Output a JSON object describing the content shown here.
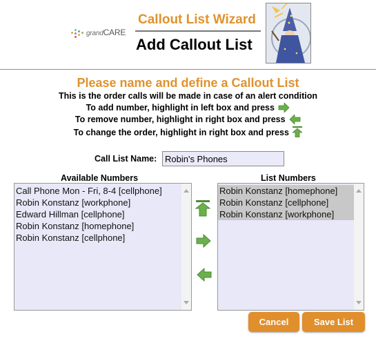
{
  "header": {
    "logo_text_grand": "grand",
    "logo_text_care": "CARE",
    "wizard_title": "Callout List Wizard",
    "page_title": "Add Callout List"
  },
  "instructions": {
    "subtitle": "Please name and define a Callout List",
    "line1": "This is the order calls will be made in case of an alert condition",
    "line2": "To add number, highlight in left box and press",
    "line3": "To remove number, highlight in right box and press",
    "line4": "To change the order, highlight in right box and press"
  },
  "form": {
    "name_label": "Call List Name:",
    "name_value": "Robin's Phones"
  },
  "available": {
    "label": "Available Numbers",
    "items": [
      "Call Phone Mon - Fri, 8-4 [cellphone]",
      "Robin Konstanz [workphone]",
      "Edward Hillman [cellphone]",
      "Robin Konstanz [homephone]",
      "Robin Konstanz [cellphone]"
    ]
  },
  "list": {
    "label": "List Numbers",
    "items": [
      "Robin Konstanz [homephone]",
      "Robin Konstanz [cellphone]",
      "Robin Konstanz [workphone]"
    ]
  },
  "buttons": {
    "cancel": "Cancel",
    "save": "Save List"
  },
  "icons": {
    "move_up": "arrow-up-to-top-icon",
    "add": "arrow-right-icon",
    "remove": "arrow-left-icon"
  },
  "colors": {
    "accent": "#e0922c",
    "arrow_green": "#6ab04c",
    "listbox_bg": "#e8e8f8",
    "selected_bg": "#c8c8c8"
  }
}
